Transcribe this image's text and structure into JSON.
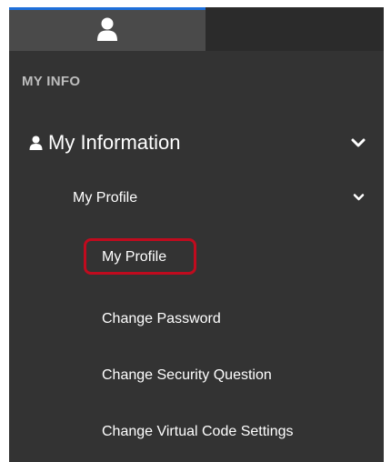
{
  "tabs": [
    {
      "icon": "user-icon",
      "active": true
    },
    {
      "icon": "",
      "active": false
    }
  ],
  "section": {
    "header": "MY INFO"
  },
  "nav": {
    "group": {
      "label": "My Information",
      "icon": "person-icon",
      "expanded": true,
      "subgroup": {
        "label": "My Profile",
        "expanded": true,
        "items": [
          {
            "label": "My Profile",
            "selected": true
          },
          {
            "label": "Change Password",
            "selected": false
          },
          {
            "label": "Change Security Question",
            "selected": false
          },
          {
            "label": "Change Virtual Code Settings",
            "selected": false
          }
        ]
      }
    }
  },
  "colors": {
    "panel_bg": "#333333",
    "tab_active_bg": "#4a4a4a",
    "tab_accent": "#1e6fd9",
    "selection_outline": "#c00b1e",
    "text": "#ffffff",
    "header_text": "#bdbdbd"
  }
}
